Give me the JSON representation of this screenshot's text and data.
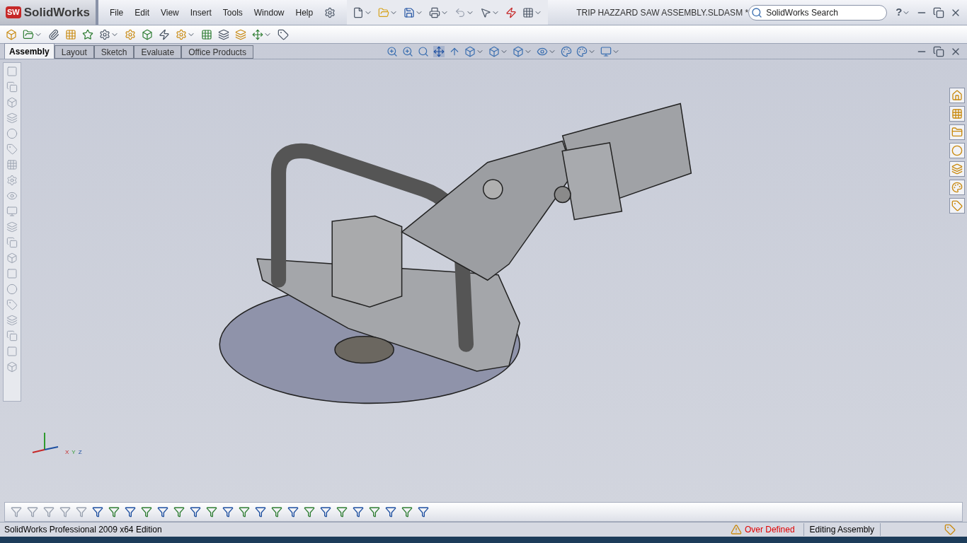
{
  "app": {
    "logo_badge": "SW",
    "logo_text": "SolidWorks"
  },
  "menu": [
    "File",
    "Edit",
    "View",
    "Insert",
    "Tools",
    "Window",
    "Help"
  ],
  "document_title": "TRIP HAZZARD SAW ASSEMBLY.SLDASM *",
  "search": {
    "placeholder": "SolidWorks Search"
  },
  "help_button": "?",
  "tabs": [
    {
      "label": "Assembly",
      "selected": true
    },
    {
      "label": "Layout",
      "selected": false
    },
    {
      "label": "Sketch",
      "selected": false
    },
    {
      "label": "Evaluate",
      "selected": false
    },
    {
      "label": "Office Products",
      "selected": false
    }
  ],
  "triad": {
    "x": "X",
    "y": "Y",
    "z": "Z"
  },
  "status_bar": {
    "edition": "SolidWorks Professional 2009 x64 Edition",
    "warning": "Over Defined",
    "mode": "Editing Assembly"
  }
}
